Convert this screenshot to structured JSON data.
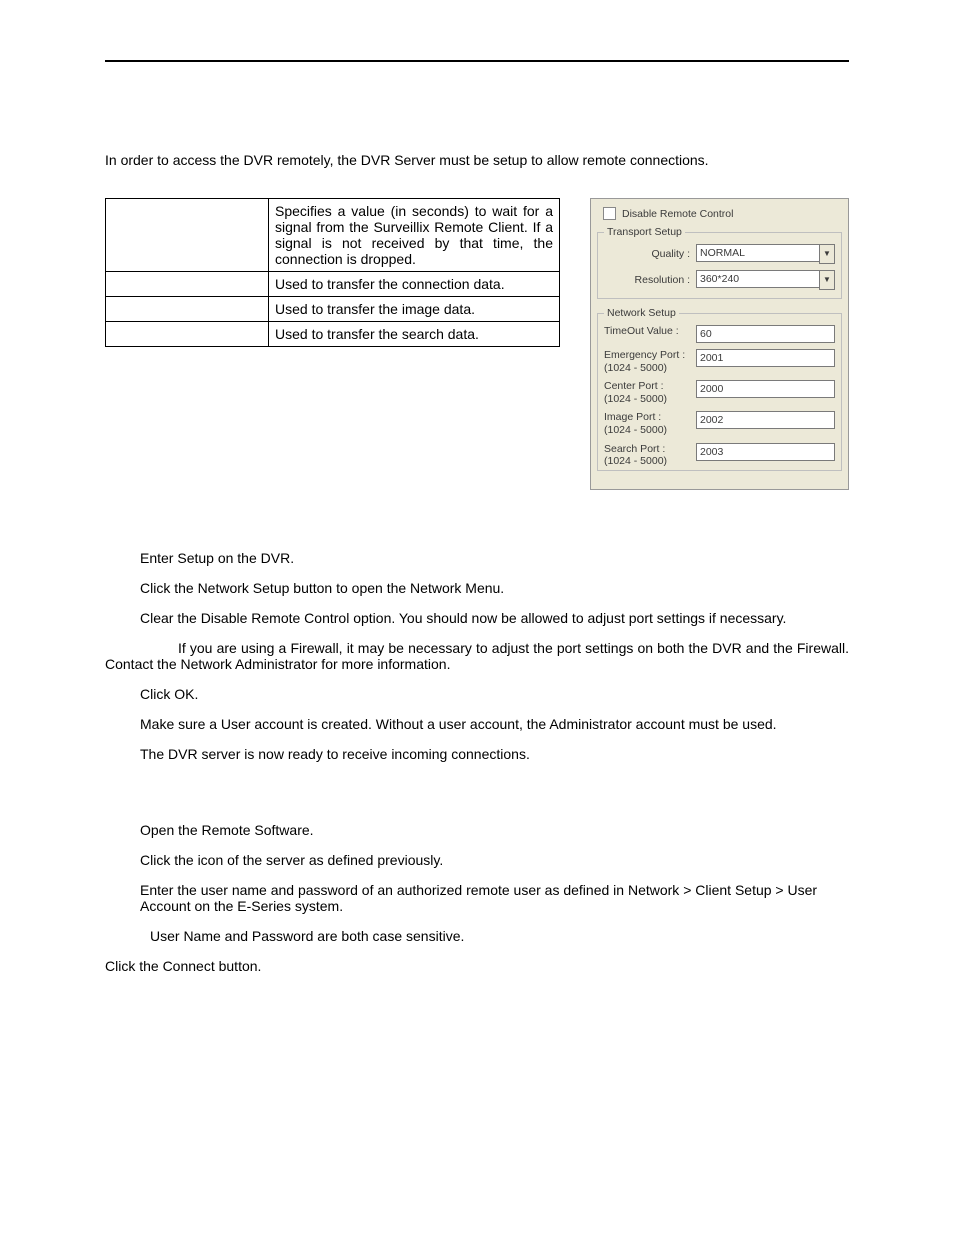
{
  "intro": "In order to access the DVR remotely, the DVR Server must be setup to allow remote connections.",
  "table_rows": [
    {
      "label": "",
      "desc": "Specifies a value (in seconds) to wait for a signal from the Surveillix Remote Client.  If a signal is not received by that time, the connection is dropped."
    },
    {
      "label": "",
      "desc": "Used to transfer the connection data."
    },
    {
      "label": "",
      "desc": "Used to transfer the image data."
    },
    {
      "label": "",
      "desc": "Used to transfer the search data."
    }
  ],
  "panel": {
    "disable_label": "Disable Remote Control",
    "transport_legend": "Transport Setup",
    "quality_label": "Quality :",
    "quality_value": "NORMAL",
    "resolution_label": "Resolution :",
    "resolution_value": "360*240",
    "network_legend": "Network Setup",
    "timeout_label": "TimeOut Value :",
    "timeout_value": "60",
    "emergency_label": "Emergency Port :",
    "range_label": "(1024 - 5000)",
    "emergency_value": "2001",
    "center_label": "Center Port :",
    "center_value": "2000",
    "image_label": "Image Port :",
    "image_value": "2002",
    "search_label": "Search Port :",
    "search_value": "2003"
  },
  "steps1": [
    "Enter Setup on the DVR.",
    "Click the Network Setup button to open the Network Menu.",
    "Clear the Disable Remote Control option. You should now be allowed to adjust port settings if necessary."
  ],
  "firewall_note": "If you are using a Firewall, it may be necessary to adjust the port settings on both the DVR and the Firewall.  Contact the Network Administrator for more information.",
  "steps1b": [
    "Click OK.",
    "Make sure a User account is created. Without a user account, the Administrator account must be used.",
    "The DVR server is now ready to receive incoming connections."
  ],
  "steps2": [
    "Open the Remote Software.",
    "Click the icon of the server as defined previously.",
    "Enter the user name and password of an authorized remote user as defined in Network > Client Setup > User Account on the E-Series system."
  ],
  "case_note": "User Name and Password are both case sensitive.",
  "steps2b": [
    "Click the Connect button."
  ]
}
